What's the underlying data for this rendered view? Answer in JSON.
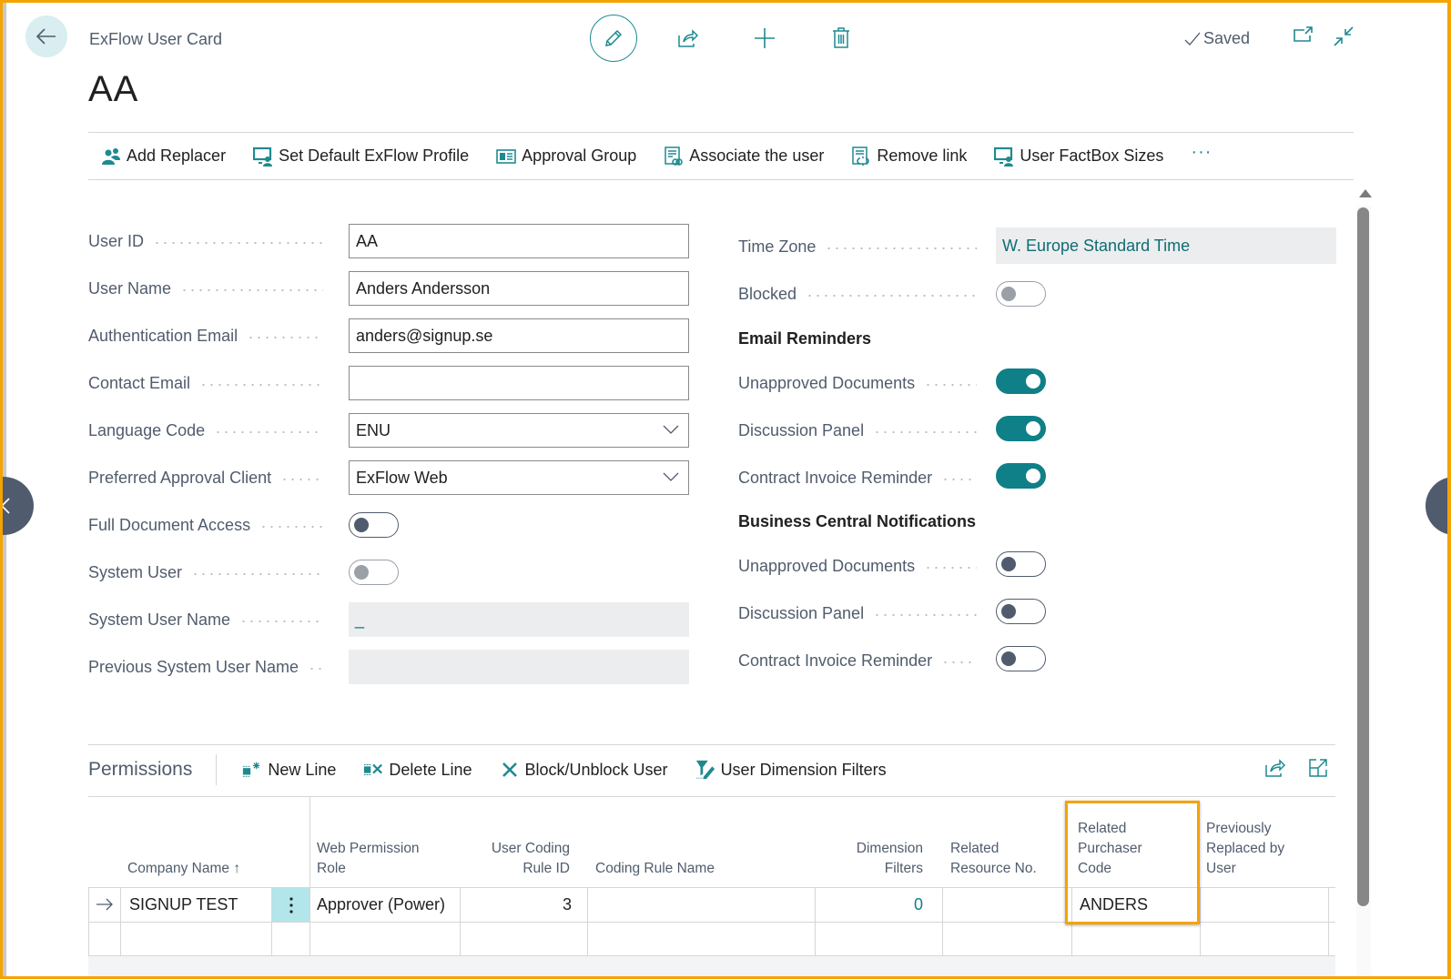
{
  "header": {
    "caption": "ExFlow User Card",
    "title": "AA",
    "status": "Saved"
  },
  "actions": [
    {
      "label": "Add Replacer",
      "icon": "users-icon"
    },
    {
      "label": "Set Default ExFlow Profile",
      "icon": "monitor-user-icon"
    },
    {
      "label": "Approval Group",
      "icon": "contact-card-icon"
    },
    {
      "label": "Associate the user",
      "icon": "document-link-icon"
    },
    {
      "label": "Remove link",
      "icon": "document-unlink-icon"
    },
    {
      "label": "User FactBox Sizes",
      "icon": "monitor-user-icon"
    }
  ],
  "more_label": "···",
  "left_fields": {
    "user_id": {
      "label": "User ID",
      "value": "AA"
    },
    "user_name": {
      "label": "User Name",
      "value": "Anders Andersson"
    },
    "auth_email": {
      "label": "Authentication Email",
      "value": "anders@signup.se"
    },
    "contact_email": {
      "label": "Contact Email",
      "value": ""
    },
    "language_code": {
      "label": "Language Code",
      "value": "ENU"
    },
    "preferred_client": {
      "label": "Preferred Approval Client",
      "value": "ExFlow Web"
    },
    "full_doc_access": {
      "label": "Full Document Access",
      "on": false
    },
    "system_user": {
      "label": "System User",
      "on": false
    },
    "system_user_name": {
      "label": "System User Name",
      "value": "_"
    },
    "prev_system_user_name": {
      "label": "Previous System User Name",
      "value": ""
    }
  },
  "right_fields": {
    "time_zone": {
      "label": "Time Zone",
      "value": "W. Europe Standard Time"
    },
    "blocked": {
      "label": "Blocked",
      "on": false
    },
    "email_reminders": {
      "title": "Email Reminders",
      "items": [
        {
          "label": "Unapproved Documents",
          "on": true
        },
        {
          "label": "Discussion Panel",
          "on": true
        },
        {
          "label": "Contract Invoice Reminder",
          "on": true
        }
      ]
    },
    "bc_notifications": {
      "title": "Business Central Notifications",
      "items": [
        {
          "label": "Unapproved Documents",
          "on": false
        },
        {
          "label": "Discussion Panel",
          "on": false
        },
        {
          "label": "Contract Invoice Reminder",
          "on": false
        }
      ]
    }
  },
  "permissions": {
    "title": "Permissions",
    "actions": [
      {
        "label": "New Line",
        "icon": "new-line-icon"
      },
      {
        "label": "Delete Line",
        "icon": "delete-line-icon"
      },
      {
        "label": "Block/Unblock User",
        "icon": "x-icon"
      },
      {
        "label": "User Dimension Filters",
        "icon": "filter-edit-icon"
      }
    ],
    "columns": [
      "Company Name ↑",
      "Web Permission Role",
      "User Coding Rule ID",
      "Coding Rule Name",
      "Dimension Filters",
      "Related Resource No.",
      "Related Purchaser Code",
      "Previously Replaced by User"
    ],
    "rows": [
      {
        "company_name": "SIGNUP TEST",
        "web_permission_role": "Approver (Power)",
        "user_coding_rule_id": "3",
        "coding_rule_name": "",
        "dimension_filters": "0",
        "related_resource_no": "",
        "related_purchaser_code": "ANDERS",
        "previously_replaced_by": ""
      }
    ]
  },
  "colors": {
    "accent": "#0f8087",
    "highlight": "#f4a300",
    "label": "#505c6d"
  }
}
